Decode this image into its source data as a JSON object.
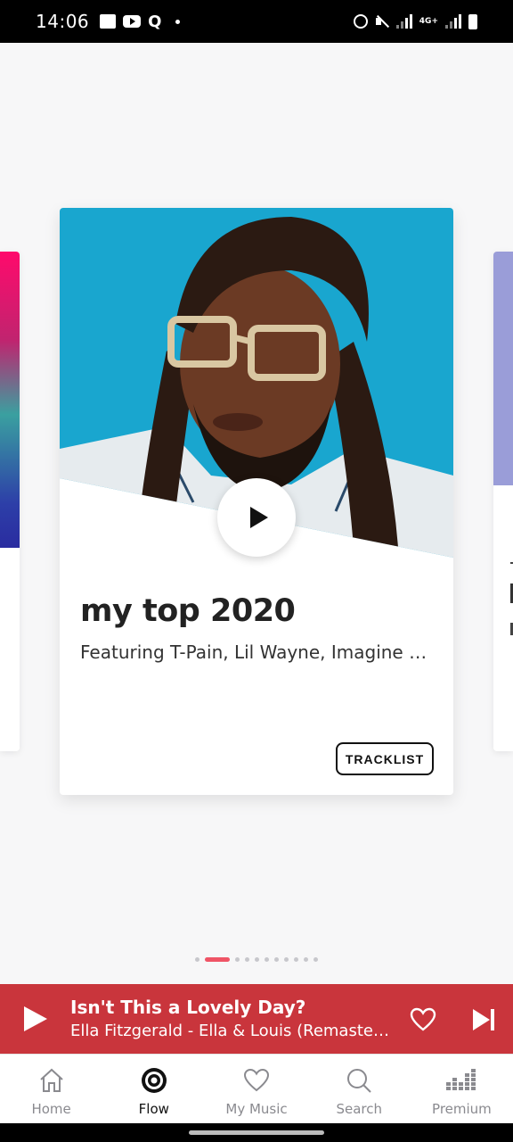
{
  "status_bar": {
    "time": "14:06",
    "q_label": "Q",
    "network_label": "4G+"
  },
  "card": {
    "title": "my top 2020",
    "subtitle": "Featuring T-Pain, Lil Wayne, Imagine Dra...",
    "tracklist_label": "TRACKLIST",
    "art_background": "#19a6cf"
  },
  "pager": {
    "count": 11,
    "active_index": 1
  },
  "mini_player": {
    "title": "Isn't This a Lovely Day?",
    "artist": "Ella Fitzgerald - Ella & Louis (Remastered,...",
    "background": "#c9353c"
  },
  "bottom_nav": {
    "items": [
      {
        "label": "Home",
        "icon": "home-icon"
      },
      {
        "label": "Flow",
        "icon": "flow-icon"
      },
      {
        "label": "My Music",
        "icon": "heart-icon"
      },
      {
        "label": "Search",
        "icon": "search-icon"
      },
      {
        "label": "Premium",
        "icon": "equalizer-icon"
      }
    ],
    "active": "Flow"
  }
}
